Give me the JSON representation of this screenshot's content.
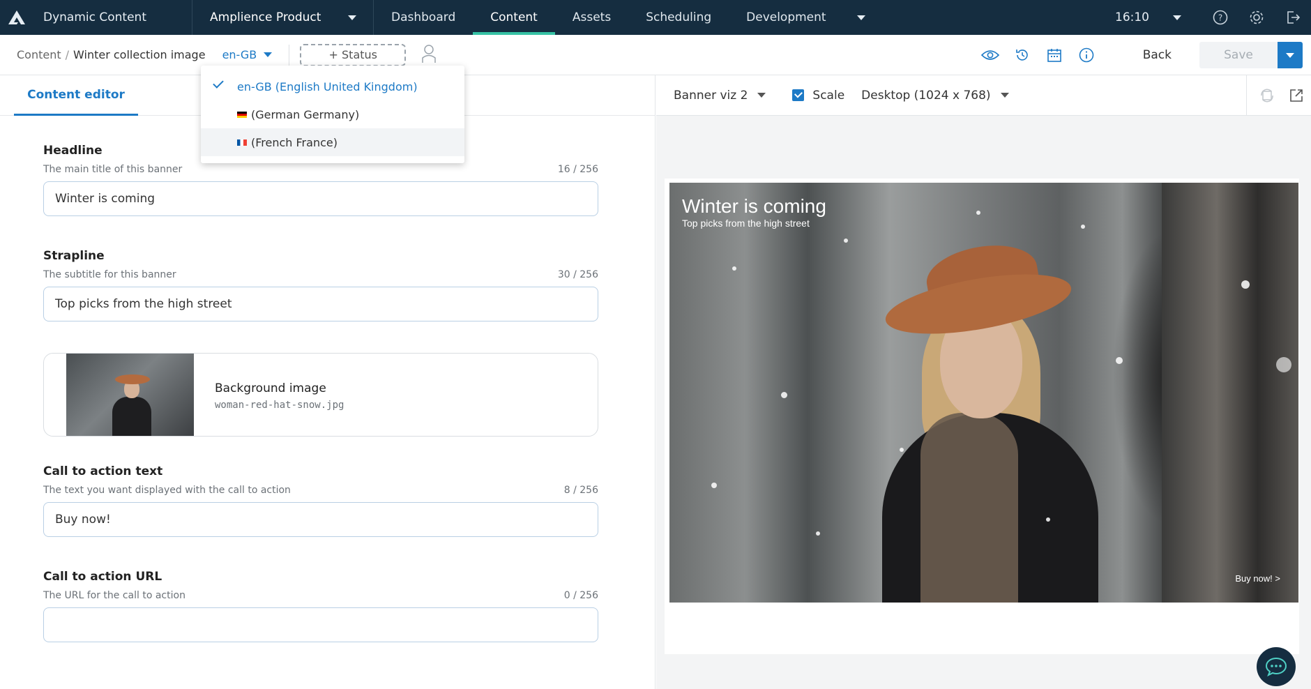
{
  "topbar": {
    "app_name": "Dynamic Content",
    "hub_name": "Amplience Product",
    "tabs": [
      {
        "label": "Dashboard"
      },
      {
        "label": "Content"
      },
      {
        "label": "Assets"
      },
      {
        "label": "Scheduling"
      },
      {
        "label": "Development"
      }
    ],
    "active_tab": "Content",
    "clock": "16:10",
    "accent_color": "#36c2a4",
    "bg_color": "#152d40"
  },
  "toolbar": {
    "breadcrumb_root": "Content",
    "breadcrumb_sep": "/",
    "breadcrumb_current": "Winter collection image",
    "locale": "en-GB",
    "status_label": "+ Status",
    "back_label": "Back",
    "save_label": "Save"
  },
  "locale_menu": {
    "items": [
      {
        "label": "en-GB (English United Kingdom)",
        "selected": true,
        "flag": ""
      },
      {
        "label": "(German Germany)",
        "selected": false,
        "flag": "de"
      },
      {
        "label": "(French France)",
        "selected": false,
        "flag": "fr"
      }
    ]
  },
  "editor": {
    "tab_label": "Content editor",
    "fields": [
      {
        "label": "Headline",
        "help": "The main title of this banner",
        "count": "16 / 256",
        "value": "Winter is coming"
      },
      {
        "label": "Strapline",
        "help": "The subtitle for this banner",
        "count": "30 / 256",
        "value": "Top picks from the high street"
      },
      {
        "label": "Call to action text",
        "help": "The text you want displayed with the call to action",
        "count": "8 / 256",
        "value": "Buy now!"
      },
      {
        "label": "Call to action URL",
        "help": "The URL for the call to action",
        "count": "0 / 256",
        "value": ""
      }
    ],
    "media": {
      "title": "Background image",
      "filename": "woman-red-hat-snow.jpg"
    }
  },
  "preview": {
    "visualization": "Banner viz 2",
    "scale_label": "Scale",
    "scale_checked": true,
    "device": "Desktop (1024 x 768)",
    "banner": {
      "headline": "Winter is coming",
      "strapline": "Top picks from the high street",
      "cta": "Buy now! >"
    }
  },
  "colors": {
    "primary": "#1d7ac6",
    "dark_navy": "#152d40"
  }
}
